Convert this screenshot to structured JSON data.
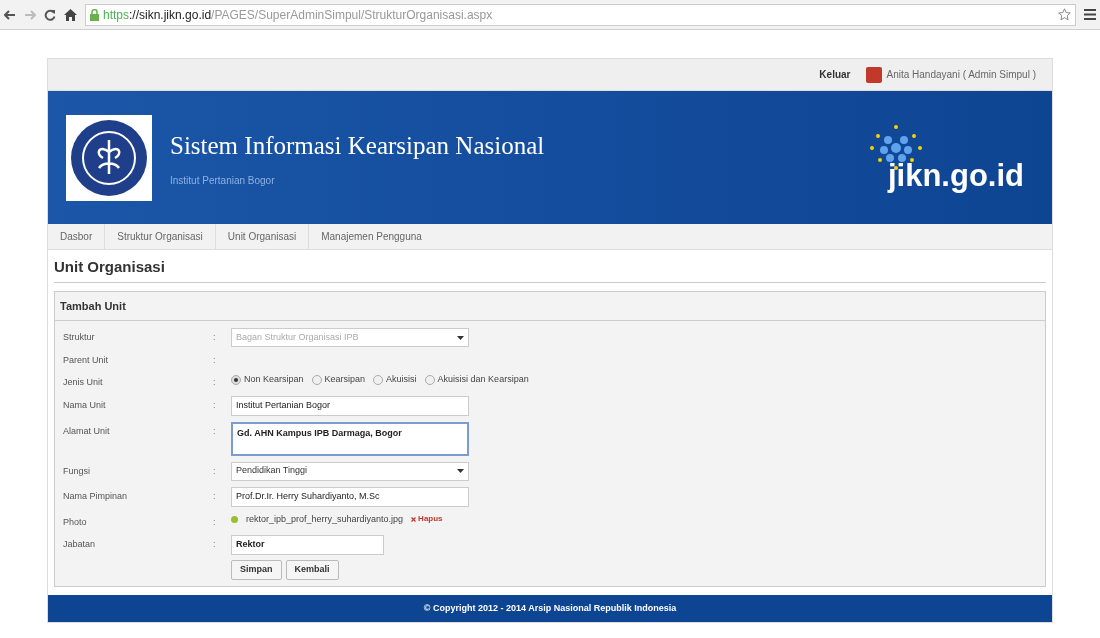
{
  "browser": {
    "url": {
      "scheme": "https",
      "host": "://sikn.jikn.go.id",
      "path": "/PAGES/SuperAdminSimpul/StrukturOrganisasi.aspx"
    }
  },
  "topbar": {
    "logout": "Keluar",
    "user": "Anita Handayani ( Admin Simpul )"
  },
  "header": {
    "title": "Sistem Informasi Kearsipan Nasional",
    "subtitle": "Institut Pertanian Bogor",
    "brand": "jikn.go.id"
  },
  "nav": [
    "Dasbor",
    "Struktur Organisasi",
    "Unit Organisasi",
    "Manajemen Pengguna"
  ],
  "page_title": "Unit Organisasi",
  "form": {
    "title": "Tambah Unit",
    "fields": [
      {
        "kind": "select",
        "label": "Struktur",
        "colon": ":",
        "value": "Bagan Struktur Organisasi IPB",
        "disabled": true
      },
      {
        "kind": "empty",
        "label": "Parent Unit",
        "colon": ":"
      },
      {
        "kind": "radio",
        "label": "Jenis Unit",
        "colon": ":",
        "options": [
          {
            "label": "Non Kearsipan",
            "selected": true
          },
          {
            "label": "Kearsipan",
            "selected": false
          },
          {
            "label": "Akuisisi",
            "selected": false
          },
          {
            "label": "Akuisisi dan Kearsipan",
            "selected": false
          }
        ]
      },
      {
        "kind": "text",
        "label": "Nama Unit",
        "colon": ":",
        "value": "Institut Pertanian Bogor"
      },
      {
        "kind": "textarea",
        "label": "Alamat Unit",
        "colon": ":",
        "value": "Gd. AHN Kampus IPB Darmaga, Bogor"
      },
      {
        "kind": "select",
        "label": "Fungsi",
        "colon": ":",
        "value": "Pendidikan Tinggi",
        "disabled": false
      },
      {
        "kind": "text",
        "label": "Nama Pimpinan",
        "colon": ":",
        "value": "Prof.Dr.Ir. Herry Suhardiyanto, M.Sc"
      },
      {
        "kind": "file",
        "label": "Photo",
        "colon": ":",
        "value": "rektor_ipb_prof_herry_suhardiyanto.jpg",
        "action": "Hapus"
      },
      {
        "kind": "short_text",
        "label": "Jabatan",
        "colon": ":",
        "value": "Rektor"
      }
    ],
    "buttons": [
      "Simpan",
      "Kembali"
    ]
  },
  "footer": "© Copyright 2012 - 2014 Arsip Nasional Republik Indonesia"
}
